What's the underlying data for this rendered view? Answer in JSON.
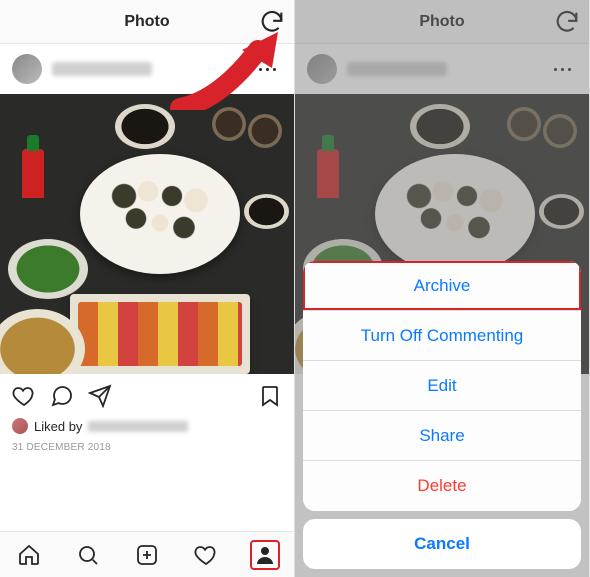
{
  "header": {
    "title": "Photo"
  },
  "post": {
    "liked_by_prefix": "Liked by",
    "date": "31 DECEMBER 2018"
  },
  "actionsheet": {
    "archive": "Archive",
    "turn_off_commenting": "Turn Off Commenting",
    "edit": "Edit",
    "share": "Share",
    "delete": "Delete",
    "cancel": "Cancel"
  }
}
